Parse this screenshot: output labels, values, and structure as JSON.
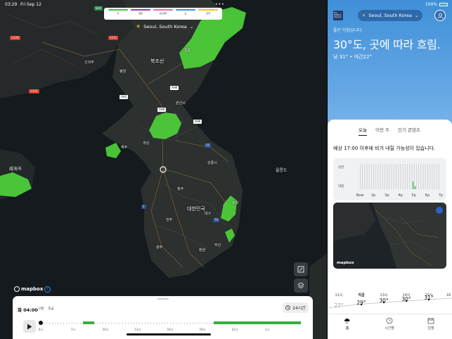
{
  "status_bar": {
    "time": "03:29",
    "date": "Fri Sep 12",
    "battery": "100%"
  },
  "map": {
    "location": "Seoul, South Korea",
    "legend": {
      "labels": [
        "비",
        "결빙",
        "진눈깨비",
        "눈",
        "번개"
      ],
      "colors": [
        "#3fbf4f",
        "#8e44ad",
        "#e96ba8",
        "#3f8fdc",
        "#f0c030"
      ]
    },
    "places": [
      {
        "name": "북조선",
        "cls": "lg"
      },
      {
        "name": "대한민국",
        "cls": "lg"
      },
      {
        "name": "울릉도",
        "cls": "md"
      },
      {
        "name": "威海市",
        "cls": "md"
      },
      {
        "name": "평양",
        "cls": ""
      },
      {
        "name": "원산시",
        "cls": ""
      },
      {
        "name": "함흥",
        "cls": ""
      },
      {
        "name": "강릉시",
        "cls": ""
      },
      {
        "name": "대구",
        "cls": ""
      },
      {
        "name": "부산",
        "cls": ""
      },
      {
        "name": "광주",
        "cls": ""
      },
      {
        "name": "청주",
        "cls": ""
      },
      {
        "name": "전주",
        "cls": ""
      },
      {
        "name": "창원",
        "cls": ""
      },
      {
        "name": "신의주",
        "cls": ""
      },
      {
        "name": "개성",
        "cls": ""
      },
      {
        "name": "해주",
        "cls": ""
      },
      {
        "name": "포항",
        "cls": ""
      }
    ],
    "shields": [
      "G228",
      "S331",
      "G331",
      "S19",
      "AH1",
      "AH6",
      "AH6",
      "AH6",
      "55",
      "1",
      "70"
    ],
    "attribution": "mapbox"
  },
  "timeline": {
    "title": "화 04:00",
    "legend_items": [
      "구름",
      "조금"
    ],
    "range_button": "24시간",
    "ticks": [
      "4시",
      "7시",
      "10시",
      "13시",
      "16시",
      "19시",
      "22시",
      "1시"
    ]
  },
  "sidebar": {
    "location": "Seoul, South Korea",
    "greeting": "좋은 아침입니다",
    "headline": "30°도, 곳에 따라 흐림.",
    "high": "낮 31°",
    "low": "야간22°",
    "brand": "The Weather Channel",
    "tabs": [
      "오늘",
      "이번 주",
      "인기 콘텐츠"
    ],
    "precip_note": "예상 17:00 이후에 비가 내릴 가능성이 있습니다.",
    "chart_labels": {
      "strong": "강한",
      "weak": "약함"
    },
    "chart_ticks": [
      "Now",
      "2p",
      "3p",
      "4p",
      "5p",
      "6p",
      "7p"
    ],
    "mini_map_attribution": "mapbox",
    "hourly": [
      {
        "time": "11시",
        "temp": "27°"
      },
      {
        "time": "지금",
        "temp": "29°"
      },
      {
        "time": "13시",
        "temp": "30°"
      },
      {
        "time": "14시",
        "temp": "30°"
      },
      {
        "time": "15시",
        "temp": "31°"
      },
      {
        "time": "16",
        "temp": ""
      }
    ],
    "nav": [
      "홈",
      "시간별",
      "일별"
    ]
  }
}
